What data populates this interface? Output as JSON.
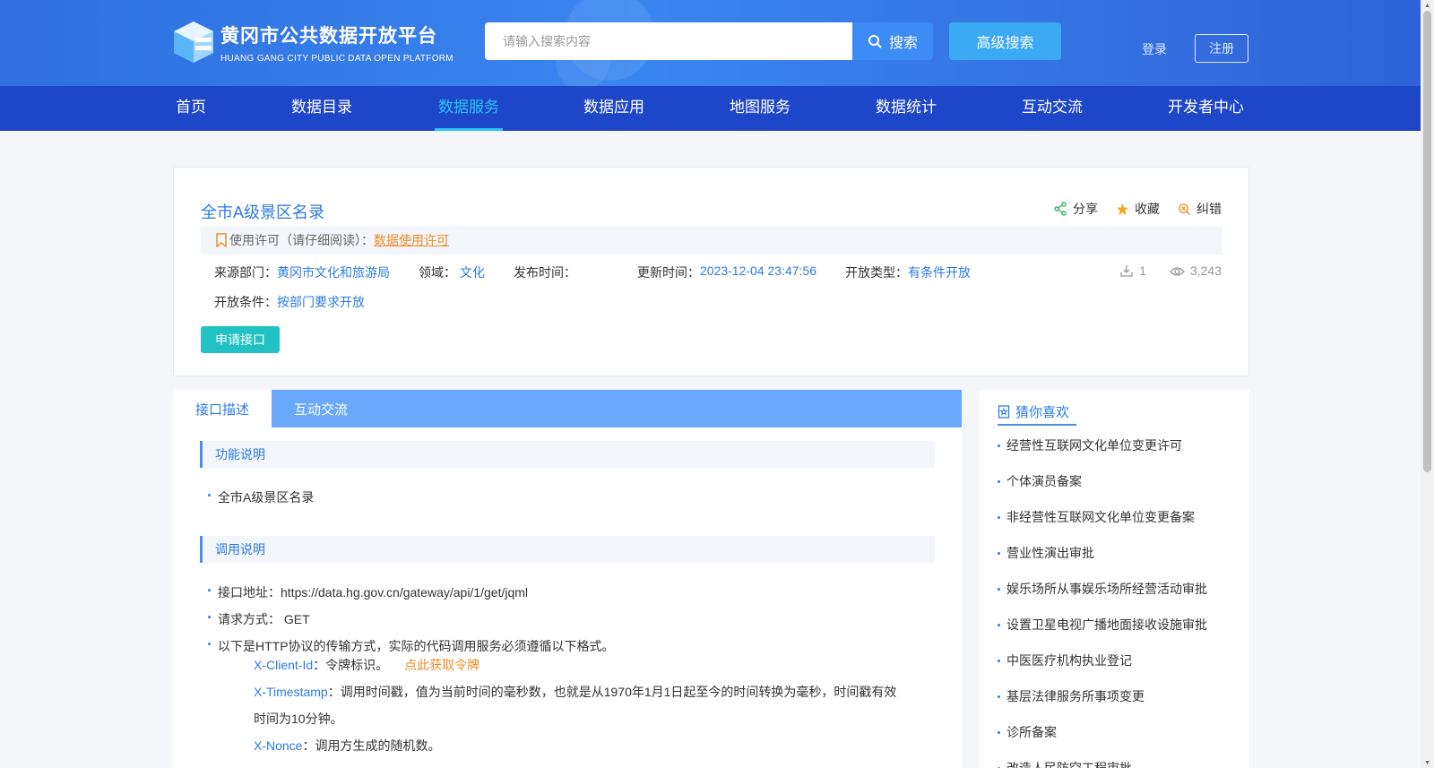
{
  "header": {
    "title": "黄冈市公共数据开放平台",
    "subtitle": "HUANG GANG CITY PUBLIC DATA OPEN  PLATFORM",
    "search_placeholder": "请输入搜索内容",
    "search_button": "搜索",
    "advanced_search": "高级搜索",
    "login": "登录",
    "register": "注册"
  },
  "nav": {
    "items": [
      "首页",
      "数据目录",
      "数据服务",
      "数据应用",
      "地图服务",
      "数据统计",
      "互动交流",
      "开发者中心"
    ],
    "active": "数据服务"
  },
  "detail": {
    "title": "全市A级景区名录",
    "share": "分享",
    "favorite": "收藏",
    "report_error": "纠错",
    "license_label": "使用许可（请仔细阅读）：",
    "license_link": "数据使用许可",
    "source_label": "来源部门：",
    "source_value": "黄冈市文化和旅游局",
    "domain_label": "领域：",
    "domain_value": "文化",
    "publish_label": "发布时间：",
    "publish_value": "",
    "update_label": "更新时间：",
    "update_value": "2023-12-04 23:47:56",
    "open_type_label": "开放类型：",
    "open_type_value": "有条件开放",
    "downloads": "1",
    "views": "3,243",
    "condition_label": "开放条件：",
    "condition_value": "按部门要求开放",
    "apply_button": "申请接口"
  },
  "tabs": [
    "接口描述",
    "互动交流"
  ],
  "content": {
    "function_head": "功能说明",
    "function_item": "全市A级景区名录",
    "call_head": "调用说明",
    "api_address": "接口地址：https://data.hg.gov.cn/gateway/api/1/get/jqml",
    "method": "请求方式： GET",
    "http_note": "以下是HTTP协议的传输方式，实际的代码调用服务必须遵循以下格式。",
    "client_id_key": "X-Client-Id",
    "client_id_desc": "：令牌标识。",
    "get_token": "点此获取令牌",
    "timestamp_key": "X-Timestamp",
    "timestamp_desc": "：调用时间戳，值为当前时间的毫秒数，也就是从1970年1月1日起至今的时间转换为毫秒，时间戳有效时间为10分钟。",
    "nonce_key": "X-Nonce",
    "nonce_desc": "：调用方生成的随机数。"
  },
  "sidebar": {
    "title": "猜你喜欢",
    "items": [
      "经营性互联网文化单位变更许可",
      "个体演员备案",
      "非经营性互联网文化单位变更备案",
      "营业性演出审批",
      "娱乐场所从事娱乐场所经营活动审批",
      "设置卫星电视广播地面接收设施审批",
      "中医医疗机构执业登记",
      "基层法律服务所事项变更",
      "诊所备案",
      "改造人民防空工程审批"
    ]
  },
  "colors": {
    "header_blue": "#3a86f0",
    "nav_blue": "#1e46c8",
    "nav_active": "#29c4f5",
    "link_blue": "#2c7be5",
    "orange": "#f08a24",
    "apply_teal": "#22c1c3"
  }
}
